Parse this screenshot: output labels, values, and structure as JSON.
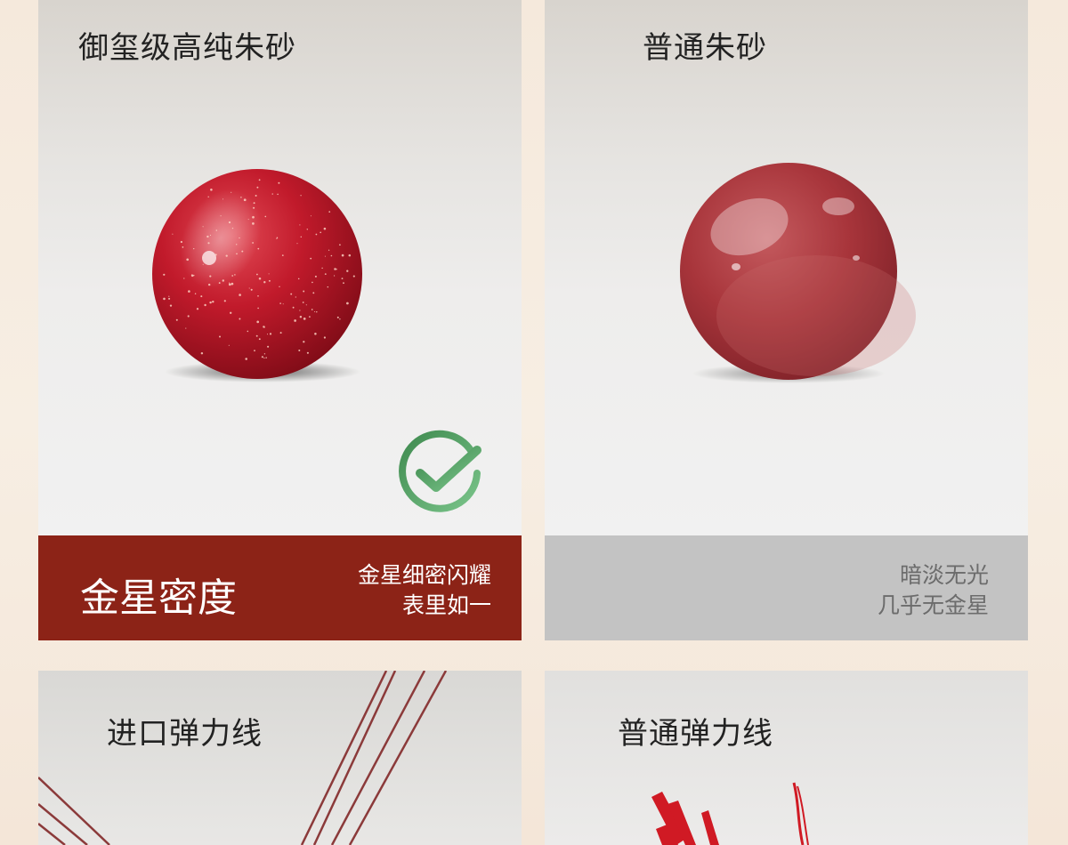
{
  "top_left": {
    "title": "御玺级高纯朱砂",
    "bar_title": "金星密度",
    "bar_line1": "金星细密闪耀",
    "bar_line2": "表里如一"
  },
  "top_right": {
    "title": "普通朱砂",
    "bar_line1": "暗淡无光",
    "bar_line2": "几乎无金星"
  },
  "bottom_left": {
    "title": "进口弹力线"
  },
  "bottom_right": {
    "title": "普通弹力线"
  },
  "colors": {
    "accent_red": "#8c2317",
    "gray_bar": "#c3c3c3",
    "check_green": "#4f9a5c"
  },
  "icons": {
    "check": "check-circle-icon"
  }
}
